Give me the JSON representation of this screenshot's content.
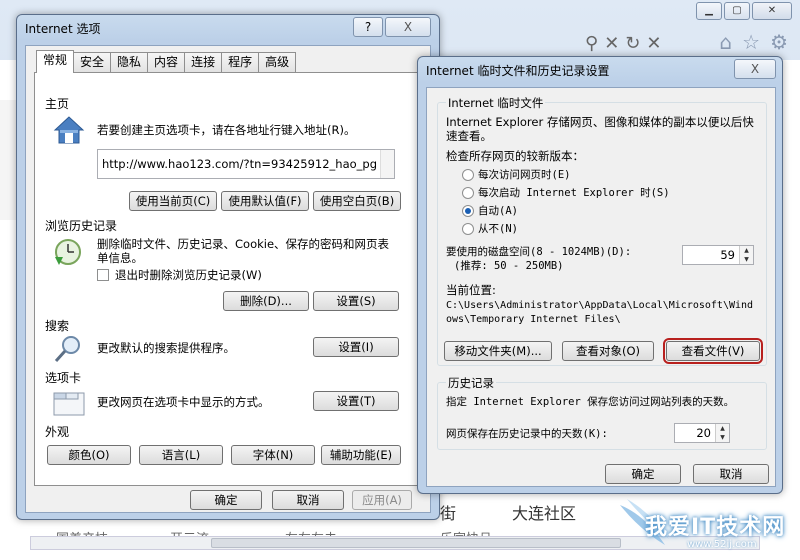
{
  "background": {
    "texts": [
      "街",
      "大连社区",
      "国差产技",
      "开元流",
      "左左左击",
      "乐家快旦"
    ],
    "watermark_main": "我爱IT技术网",
    "watermark_url": "www.52ij.com"
  },
  "options_window": {
    "title": "Internet 选项",
    "help": "?",
    "close": "X",
    "tabs": [
      "常规",
      "安全",
      "隐私",
      "内容",
      "连接",
      "程序",
      "高级"
    ],
    "homepage": {
      "label": "主页",
      "desc": "若要创建主页选项卡，请在各地址行键入地址(R)。",
      "url": "http://www.hao123.com/?tn=93425912_hao_pg",
      "btn_current": "使用当前页(C)",
      "btn_default": "使用默认值(F)",
      "btn_blank": "使用空白页(B)"
    },
    "history": {
      "label": "浏览历史记录",
      "desc": "删除临时文件、历史记录、Cookie、保存的密码和网页表单信息。",
      "checkbox": "退出时删除浏览历史记录(W)",
      "btn_delete": "删除(D)...",
      "btn_settings": "设置(S)"
    },
    "search": {
      "label": "搜索",
      "desc": "更改默认的搜索提供程序。",
      "btn_settings": "设置(I)"
    },
    "tabsgroup": {
      "label": "选项卡",
      "desc": "更改网页在选项卡中显示的方式。",
      "btn_settings": "设置(T)"
    },
    "appearance": {
      "label": "外观",
      "btn_colors": "颜色(O)",
      "btn_languages": "语言(L)",
      "btn_fonts": "字体(N)",
      "btn_accessibility": "辅助功能(E)"
    },
    "footer": {
      "ok": "确定",
      "cancel": "取消",
      "apply": "应用(A)"
    }
  },
  "temp_dialog": {
    "title": "Internet 临时文件和历史记录设置",
    "close": "X",
    "temp_group": {
      "title": "Internet 临时文件",
      "desc": "Internet Explorer 存储网页、图像和媒体的副本以便以后快速查看。",
      "check_label": "检查所存网页的较新版本：",
      "options": [
        "每次访问网页时(E)",
        "每次启动 Internet Explorer 时(S)",
        "自动(A)",
        "从不(N)"
      ],
      "selected_index": 2,
      "disk_label": "要使用的磁盘空间(8 - 1024MB)(D):",
      "disk_hint": "(推荐: 50 - 250MB)",
      "disk_value": "59",
      "location_label": "当前位置:",
      "location_path": "C:\\Users\\Administrator\\AppData\\Local\\Microsoft\\Windows\\Temporary Internet Files\\",
      "btn_move": "移动文件夹(M)...",
      "btn_objects": "查看对象(O)",
      "btn_files": "查看文件(V)"
    },
    "history_group": {
      "title": "历史记录",
      "desc": "指定 Internet Explorer 保存您访问过网站列表的天数。",
      "days_label": "网页保存在历史记录中的天数(K):",
      "days_value": "20"
    },
    "footer": {
      "ok": "确定",
      "cancel": "取消"
    }
  }
}
